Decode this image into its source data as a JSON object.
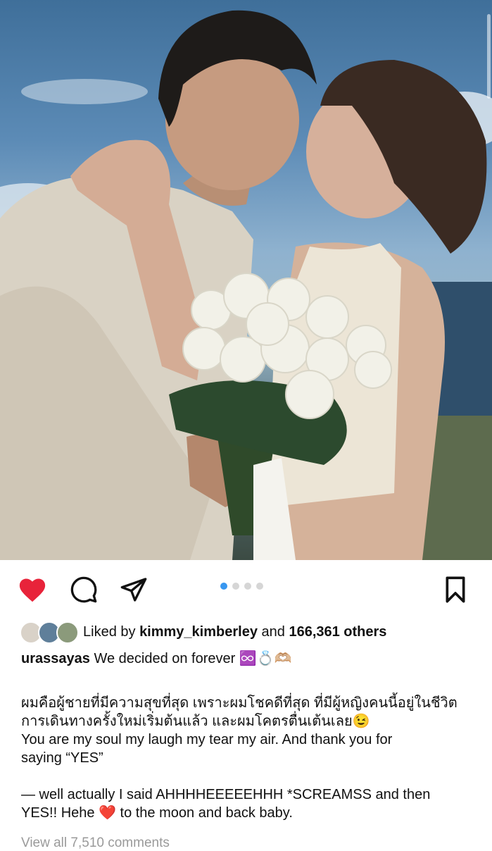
{
  "post": {
    "username": "urassayas",
    "caption_title": "We decided on forever",
    "caption_emoji": "♾️💍🫶🏼"
  },
  "carousel": {
    "total": 4,
    "active": 1
  },
  "likes": {
    "prefix": "Liked by",
    "user": "kimmy_kimberley",
    "middle": "and",
    "count": "166,361 others"
  },
  "caption_body": {
    "thai_line1": "ผมคือผู้ชายที่มีความสุขที่สุด เพราะผมโชคดีที่สุด ที่มีผู้หญิงคนนี้อยู่ในชีวิต",
    "thai_line2": "การเดินทางครั้งใหม่เริ่มต้นแล้ว และผมโคตรตื่นเต้นเลย😉",
    "english_line1": "You are my soul my laugh my tear my air. And thank you for",
    "english_line2": "saying “YES”",
    "quote_line1": "— well actually I said AHHHHEEEEEHHH *SCREAMSS and then",
    "quote_line2": "YES!! Hehe ❤️ to the moon and back baby."
  },
  "comments": {
    "view_all": "View all 7,510 comments"
  },
  "icons": [
    "heart-icon",
    "comment-icon",
    "share-icon",
    "bookmark-icon"
  ],
  "colors": {
    "like": "#e8233a",
    "carousel_active": "#3897f0"
  }
}
